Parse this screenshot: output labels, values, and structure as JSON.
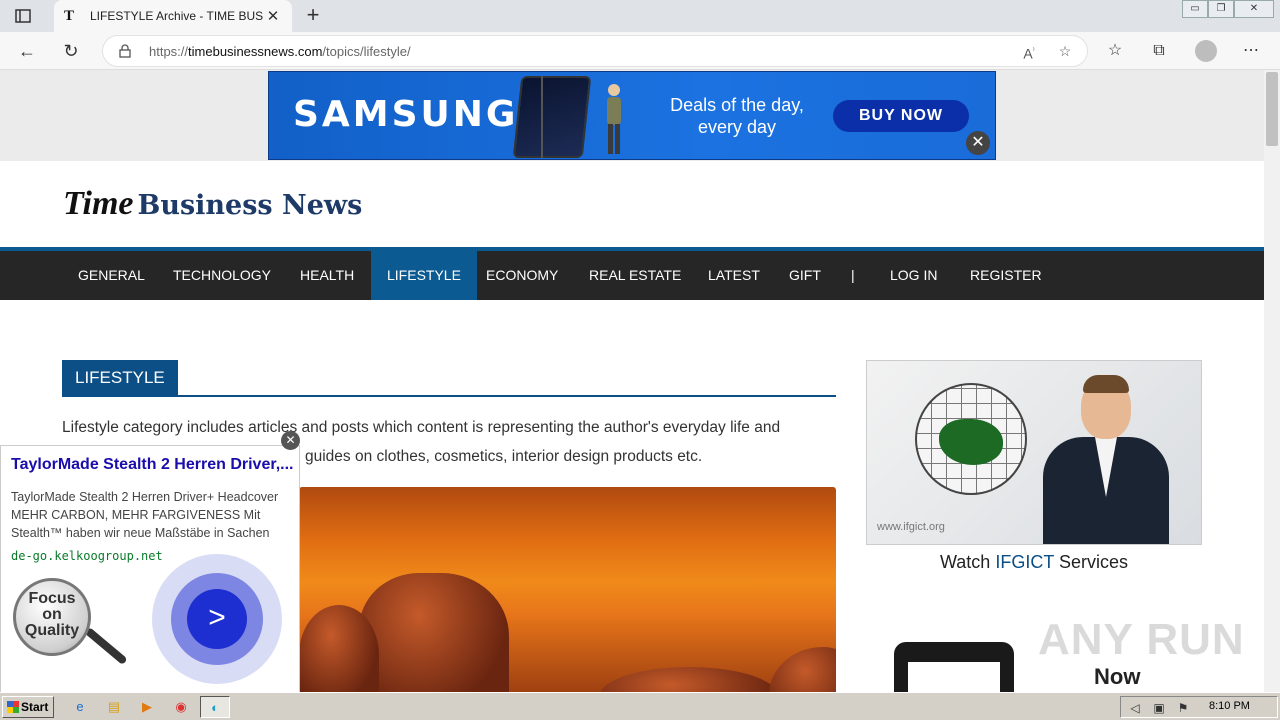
{
  "browser": {
    "tab": {
      "favicon": "T",
      "title": "LIFESTYLE Archive - TIME BUSINESS NEWS",
      "close_glyph": "✕"
    },
    "new_tab_glyph": "+",
    "url_prefix": "https://",
    "url_domain": "timebusinessnews.com",
    "url_path": "/topics/lifestyle/",
    "window_controls": [
      "▭",
      "❐",
      "✕"
    ]
  },
  "ad_banner": {
    "brand": "SAMSUNG",
    "tagline_line1": "Deals of the day,",
    "tagline_line2": "every day",
    "cta": "BUY NOW",
    "close_glyph": "✕",
    "color": "#1b72e0"
  },
  "site": {
    "logo_time": "Time",
    "logo_rest": "Business News"
  },
  "nav": {
    "items": [
      {
        "label": "GENERAL"
      },
      {
        "label": "TECHNOLOGY"
      },
      {
        "label": "HEALTH"
      },
      {
        "label": "LIFESTYLE",
        "active": true
      },
      {
        "label": "ECONOMY"
      },
      {
        "label": "REAL ESTATE"
      },
      {
        "label": "LATEST"
      },
      {
        "label": "GIFT"
      },
      {
        "label": "|"
      },
      {
        "label": "LOG IN"
      },
      {
        "label": "REGISTER"
      }
    ],
    "active_color": "#0b5a91"
  },
  "content": {
    "section_title": "LIFESTYLE",
    "intro_line1": "Lifestyle category includes articles and posts which content is representing the author's everyday life and",
    "intro_line2": "guides on clothes, cosmetics, interior design products etc."
  },
  "sidebar": {
    "ifgict_url": "www.ifgict.org",
    "watch_prefix": "Watch ",
    "watch_highlight": "IFGICT",
    "watch_suffix": " Services",
    "now_text": "Now",
    "watermark": "ANY RUN"
  },
  "popup_ad": {
    "title": "TaylorMade Stealth 2 Herren Driver,...",
    "desc_line1": "TaylorMade Stealth 2 Herren Driver+ Headcover",
    "desc_line2": "MEHR CARBON, MEHR FARGIVENESS Mit",
    "desc_line3": "Stealth™ haben wir neue Maßstäbe in Sachen",
    "host": "de-go.kelkoogroup.net",
    "badge_line1": "Focus",
    "badge_line2": "on",
    "badge_line3": "Quality",
    "go_glyph": ">",
    "close_glyph": "✕"
  },
  "taskbar": {
    "start_label": "Start",
    "clock": "8:10 PM"
  }
}
